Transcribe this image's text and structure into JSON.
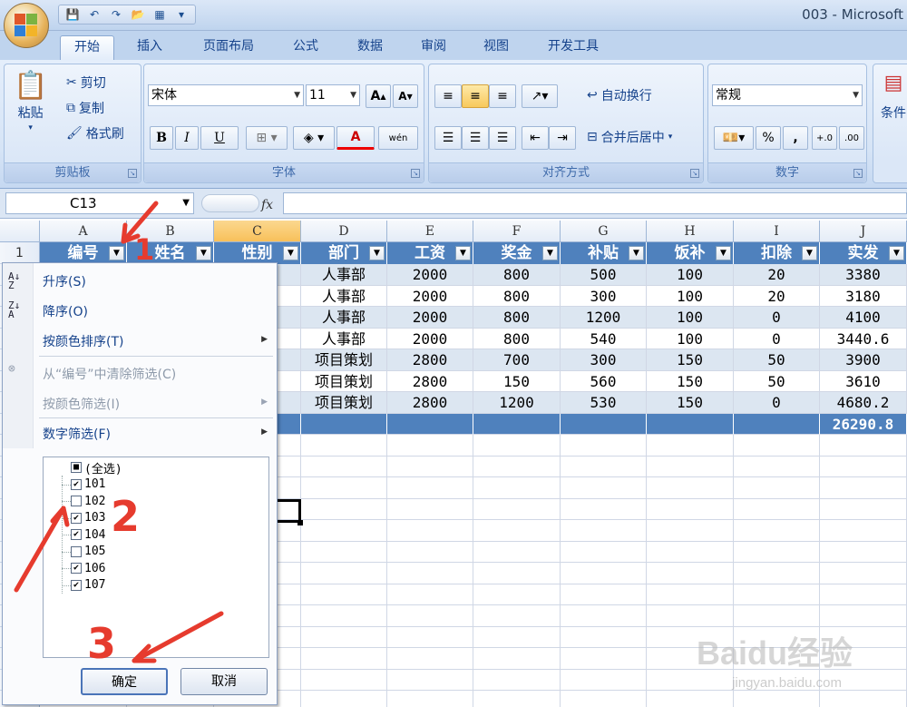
{
  "window": {
    "title": "003 - Microsoft"
  },
  "tabs": [
    "开始",
    "插入",
    "页面布局",
    "公式",
    "数据",
    "审阅",
    "视图",
    "开发工具"
  ],
  "ribbon": {
    "clipboard": {
      "label": "剪贴板",
      "paste": "粘贴",
      "cut": "剪切",
      "copy": "复制",
      "format_painter": "格式刷"
    },
    "font": {
      "label": "字体",
      "font_name": "宋体",
      "font_size": "11",
      "bold": "B",
      "italic": "I",
      "underline": "U",
      "font_color": "A",
      "phonetic": "wén"
    },
    "alignment": {
      "label": "对齐方式",
      "wrap_text": "自动换行",
      "merge_center": "合并后居中"
    },
    "number": {
      "label": "数字",
      "format": "常规",
      "percent": "%",
      "comma": ",",
      "inc_decimal": "+.0",
      "dec_decimal": ".00"
    },
    "styles": {
      "label_partial": "条件"
    }
  },
  "formula_bar": {
    "name_box": "C13",
    "fx": "fx",
    "value": ""
  },
  "columns": [
    "A",
    "B",
    "C",
    "D",
    "E",
    "F",
    "G",
    "H",
    "I",
    "J"
  ],
  "header_row": {
    "row_num": "1",
    "cells": [
      "编号",
      "姓名",
      "性别",
      "部门",
      "工资",
      "奖金",
      "补贴",
      "饭补",
      "扣除",
      "实发"
    ]
  },
  "data_rows": [
    [
      "人事部",
      "2000",
      "800",
      "500",
      "100",
      "20",
      "3380"
    ],
    [
      "人事部",
      "2000",
      "800",
      "300",
      "100",
      "20",
      "3180"
    ],
    [
      "人事部",
      "2000",
      "800",
      "1200",
      "100",
      "0",
      "4100"
    ],
    [
      "人事部",
      "2000",
      "800",
      "540",
      "100",
      "0",
      "3440.6"
    ],
    [
      "项目策划",
      "2800",
      "700",
      "300",
      "150",
      "50",
      "3900"
    ],
    [
      "项目策划",
      "2800",
      "150",
      "560",
      "150",
      "50",
      "3610"
    ],
    [
      "项目策划",
      "2800",
      "1200",
      "530",
      "150",
      "0",
      "4680.2"
    ]
  ],
  "total": "26290.8",
  "filter_menu": {
    "sort_asc": "升序(S)",
    "sort_desc": "降序(O)",
    "sort_by_color": "按颜色排序(T)",
    "clear_filter": "从“编号”中清除筛选(C)",
    "filter_by_color": "按颜色筛选(I)",
    "number_filter": "数字筛选(F)",
    "items": [
      {
        "label": "(全选)",
        "state": "■"
      },
      {
        "label": "101",
        "state": "✔"
      },
      {
        "label": "102",
        "state": ""
      },
      {
        "label": "103",
        "state": "✔"
      },
      {
        "label": "104",
        "state": "✔"
      },
      {
        "label": "105",
        "state": ""
      },
      {
        "label": "106",
        "state": "✔"
      },
      {
        "label": "107",
        "state": "✔"
      }
    ],
    "ok": "确定",
    "cancel": "取消"
  },
  "annotations": [
    "1",
    "2",
    "3"
  ],
  "watermark": {
    "brand": "Baidu经验",
    "url": "jingyan.baidu.com"
  },
  "colors": {
    "header_fill": "#4f81bd",
    "annotation": "#e63b2e",
    "selected_col": "#f8c05a"
  }
}
